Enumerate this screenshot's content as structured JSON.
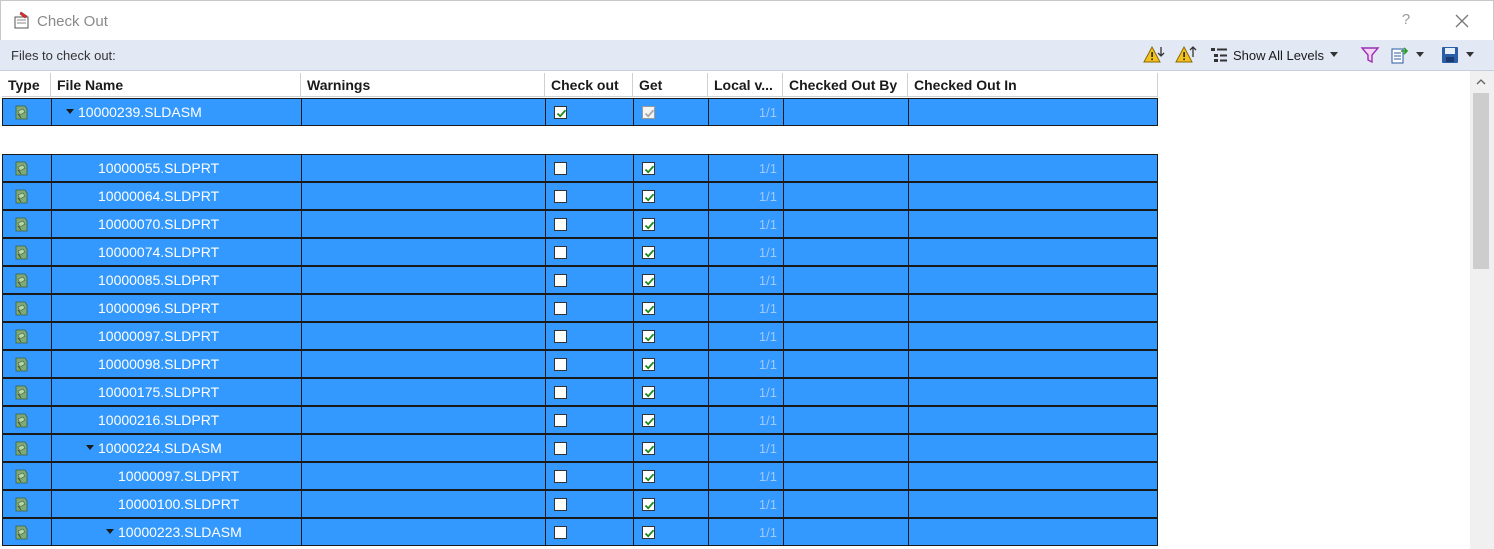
{
  "window": {
    "title": "Check Out",
    "help_label": "?"
  },
  "toolbar": {
    "label": "Files to check out:",
    "show_levels_label": "Show All Levels"
  },
  "columns": [
    "Type",
    "File Name",
    "Warnings",
    "Check out",
    "Get",
    "Local v...",
    "Checked Out By",
    "Checked Out In"
  ],
  "rows": [
    {
      "name": "10000239.SLDASM",
      "level": 0,
      "expandable": true,
      "check_out": true,
      "get": true,
      "get_disabled": true,
      "local_version": "1/1",
      "slot": 0
    },
    {
      "name": "10000055.SLDPRT",
      "level": 1,
      "expandable": false,
      "check_out": false,
      "get": true,
      "get_disabled": false,
      "local_version": "1/1",
      "slot": 2
    },
    {
      "name": "10000064.SLDPRT",
      "level": 1,
      "expandable": false,
      "check_out": false,
      "get": true,
      "get_disabled": false,
      "local_version": "1/1",
      "slot": 3
    },
    {
      "name": "10000070.SLDPRT",
      "level": 1,
      "expandable": false,
      "check_out": false,
      "get": true,
      "get_disabled": false,
      "local_version": "1/1",
      "slot": 4
    },
    {
      "name": "10000074.SLDPRT",
      "level": 1,
      "expandable": false,
      "check_out": false,
      "get": true,
      "get_disabled": false,
      "local_version": "1/1",
      "slot": 5
    },
    {
      "name": "10000085.SLDPRT",
      "level": 1,
      "expandable": false,
      "check_out": false,
      "get": true,
      "get_disabled": false,
      "local_version": "1/1",
      "slot": 6
    },
    {
      "name": "10000096.SLDPRT",
      "level": 1,
      "expandable": false,
      "check_out": false,
      "get": true,
      "get_disabled": false,
      "local_version": "1/1",
      "slot": 7
    },
    {
      "name": "10000097.SLDPRT",
      "level": 1,
      "expandable": false,
      "check_out": false,
      "get": true,
      "get_disabled": false,
      "local_version": "1/1",
      "slot": 8
    },
    {
      "name": "10000098.SLDPRT",
      "level": 1,
      "expandable": false,
      "check_out": false,
      "get": true,
      "get_disabled": false,
      "local_version": "1/1",
      "slot": 9
    },
    {
      "name": "10000175.SLDPRT",
      "level": 1,
      "expandable": false,
      "check_out": false,
      "get": true,
      "get_disabled": false,
      "local_version": "1/1",
      "slot": 10
    },
    {
      "name": "10000216.SLDPRT",
      "level": 1,
      "expandable": false,
      "check_out": false,
      "get": true,
      "get_disabled": false,
      "local_version": "1/1",
      "slot": 11
    },
    {
      "name": "10000224.SLDASM",
      "level": 1,
      "expandable": true,
      "check_out": false,
      "get": true,
      "get_disabled": false,
      "local_version": "1/1",
      "slot": 12
    },
    {
      "name": "10000097.SLDPRT",
      "level": 2,
      "expandable": false,
      "check_out": false,
      "get": true,
      "get_disabled": false,
      "local_version": "1/1",
      "slot": 13
    },
    {
      "name": "10000100.SLDPRT",
      "level": 2,
      "expandable": false,
      "check_out": false,
      "get": true,
      "get_disabled": false,
      "local_version": "1/1",
      "slot": 14
    },
    {
      "name": "10000223.SLDASM",
      "level": 2,
      "expandable": true,
      "check_out": false,
      "get": true,
      "get_disabled": false,
      "local_version": "1/1",
      "slot": 15
    }
  ],
  "colors": {
    "selection": "#3399ff",
    "toolbar_bg": "#e2e8f4",
    "check_green": "#1a8a1a",
    "version_text": "#9ecbf8"
  },
  "icons": {
    "title": "checkout-document-icon",
    "warning_down": "warning-down-icon",
    "warning_up": "warning-up-icon",
    "levels": "tree-levels-icon",
    "filter": "filter-icon",
    "export": "export-icon",
    "save": "save-icon",
    "type": "assembly-file-icon"
  }
}
